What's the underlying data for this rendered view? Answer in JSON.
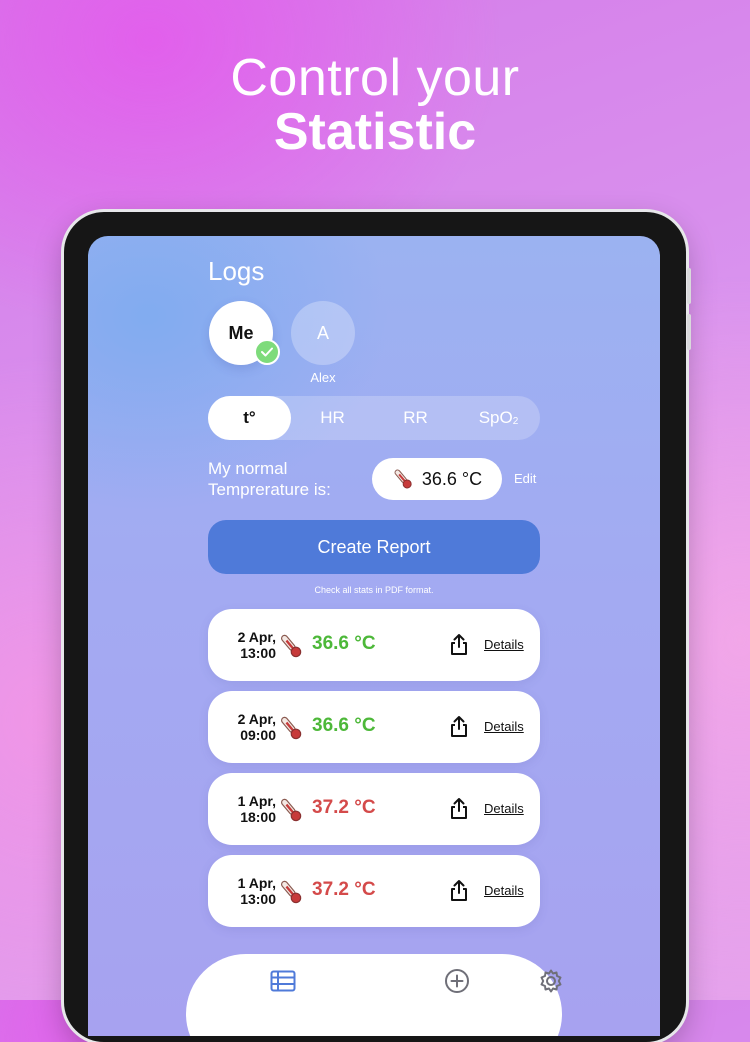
{
  "promo": {
    "line1": "Control your",
    "line2": "Statistic"
  },
  "screen": {
    "title": "Logs",
    "profiles": [
      {
        "initials": "Me",
        "selected": true,
        "label": ""
      },
      {
        "initials": "A",
        "selected": false,
        "label": "Alex"
      }
    ],
    "metric_tabs": [
      {
        "label": "t°",
        "active": true
      },
      {
        "label": "HR",
        "active": false
      },
      {
        "label": "RR",
        "active": false
      },
      {
        "label": "SpO",
        "subscript": "2",
        "active": false
      }
    ],
    "normal_temp": {
      "label_line1": "My normal",
      "label_line2": "Temprerature is:",
      "value": "36.6 °C",
      "edit_label": "Edit"
    },
    "report": {
      "button_label": "Create Report",
      "hint": "Check all stats in PDF format."
    },
    "logs": [
      {
        "date": "2 Apr,",
        "time": "13:00",
        "temp": "36.6 °C",
        "status": "normal",
        "details_label": "Details"
      },
      {
        "date": "2 Apr,",
        "time": "09:00",
        "temp": "36.6 °C",
        "status": "normal",
        "details_label": "Details"
      },
      {
        "date": "1 Apr,",
        "time": "18:00",
        "temp": "37.2 °C",
        "status": "high",
        "details_label": "Details"
      },
      {
        "date": "1 Apr,",
        "time": "13:00",
        "temp": "37.2 °C",
        "status": "high",
        "details_label": "Details"
      }
    ],
    "tabbar": {
      "icons": [
        "list-icon",
        "add-circle-icon",
        "settings-icon"
      ],
      "active_index": 0
    }
  },
  "colors": {
    "accent": "#4f7ad9",
    "normal_temp": "#4db839",
    "high_temp": "#d44a4a",
    "check": "#7edb7b"
  }
}
